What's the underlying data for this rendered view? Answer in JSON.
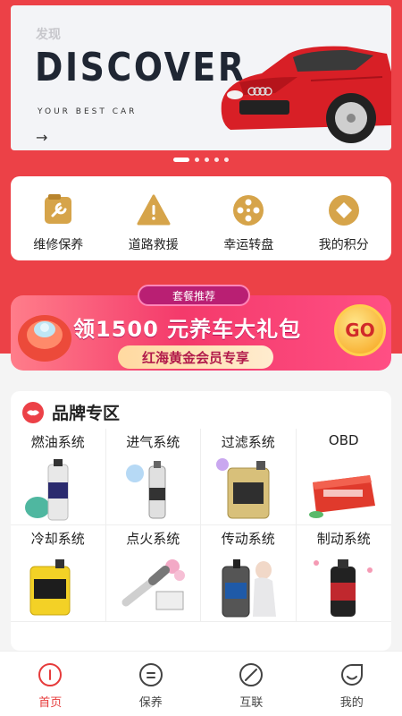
{
  "banner": {
    "small": "发现",
    "big": "DISCOVER",
    "sub": "YOUR BEST CAR",
    "arrow": "→",
    "slide_count": 5,
    "active_slide": 1
  },
  "quick_actions": [
    {
      "label": "维修保养",
      "icon": "wrench-icon"
    },
    {
      "label": "道路救援",
      "icon": "warning-icon"
    },
    {
      "label": "幸运转盘",
      "icon": "wheel-icon"
    },
    {
      "label": "我的积分",
      "icon": "diamond-icon"
    }
  ],
  "promo": {
    "tag": "套餐推荐",
    "title": "领1500 元养车大礼包",
    "sub": "红海黄金会员专享",
    "go": "GO"
  },
  "brand": {
    "title": "品牌专区",
    "items": [
      {
        "label": "燃油系统"
      },
      {
        "label": "进气系统"
      },
      {
        "label": "过滤系统"
      },
      {
        "label": "OBD"
      },
      {
        "label": "冷却系统"
      },
      {
        "label": "点火系统"
      },
      {
        "label": "传动系统"
      },
      {
        "label": "制动系统"
      }
    ]
  },
  "tabs": [
    {
      "label": "首页",
      "icon": "home-icon",
      "active": true
    },
    {
      "label": "保养",
      "icon": "maintenance-icon",
      "active": false
    },
    {
      "label": "互联",
      "icon": "connect-icon",
      "active": false
    },
    {
      "label": "我的",
      "icon": "profile-icon",
      "active": false
    }
  ],
  "colors": {
    "accent": "#ec4147",
    "gold": "#d6a44a",
    "tab_active": "#e63b3b"
  }
}
